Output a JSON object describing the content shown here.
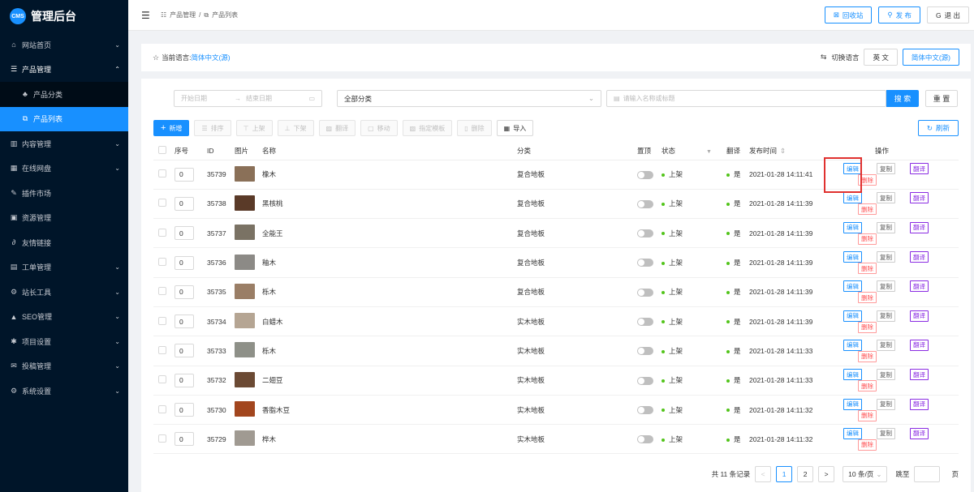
{
  "app": {
    "logo_badge": "CMS",
    "title": "管理后台"
  },
  "sidebar": {
    "items": [
      {
        "icon": "⌂",
        "label": "网站首页",
        "arrow": "⌄"
      },
      {
        "icon": "☰",
        "label": "产品管理",
        "arrow": "⌃"
      },
      {
        "icon": "▥",
        "label": "内容管理",
        "arrow": "⌄"
      },
      {
        "icon": "▦",
        "label": "在线网盘",
        "arrow": "⌄"
      },
      {
        "icon": "✎",
        "label": "插件市场",
        "arrow": ""
      },
      {
        "icon": "▣",
        "label": "资源管理",
        "arrow": ""
      },
      {
        "icon": "∂",
        "label": "友情链接",
        "arrow": ""
      },
      {
        "icon": "▤",
        "label": "工单管理",
        "arrow": "⌄"
      },
      {
        "icon": "⚙",
        "label": "站长工具",
        "arrow": "⌄"
      },
      {
        "icon": "▲",
        "label": "SEO管理",
        "arrow": "⌄"
      },
      {
        "icon": "✱",
        "label": "项目设置",
        "arrow": "⌄"
      },
      {
        "icon": "✉",
        "label": "投稿管理",
        "arrow": "⌄"
      },
      {
        "icon": "⚙",
        "label": "系统设置",
        "arrow": "⌄"
      }
    ],
    "submenu": [
      {
        "icon": "♣",
        "label": "产品分类"
      },
      {
        "icon": "⧉",
        "label": "产品列表"
      }
    ]
  },
  "topbar": {
    "fold_icon": "☰",
    "breadcrumb": [
      {
        "icon": "☷",
        "label": "产品管理"
      },
      {
        "icon": "⧉",
        "label": "产品列表"
      }
    ],
    "sep": "/",
    "recycle": {
      "icon": "⊠",
      "label": "回收站"
    },
    "publish": {
      "icon": "⚲",
      "label": "发 布"
    },
    "logout": {
      "icon": "G",
      "label": "退 出"
    }
  },
  "langbar": {
    "star": "☆",
    "label": "当前语言:",
    "current": "简体中文(源)",
    "switch_icon": "⇆",
    "switch_label": "切换语言",
    "options": [
      "英 文",
      "简体中文(源)"
    ]
  },
  "filters": {
    "start_date": "开始日期",
    "arrow": "→",
    "end_date": "结束日期",
    "calendar": "▭",
    "category": "全部分类",
    "caret": "⌄",
    "search_icon": "▤",
    "search_placeholder": "请输入名称或标题",
    "search_btn": "搜 索",
    "reset_btn": "重 置"
  },
  "toolbar": {
    "buttons": [
      {
        "icon": "+",
        "label": "新增"
      },
      {
        "icon": "☰",
        "label": "排序"
      },
      {
        "icon": "⊤",
        "label": "上架"
      },
      {
        "icon": "⊥",
        "label": "下架"
      },
      {
        "icon": "▨",
        "label": "翻译"
      },
      {
        "icon": "▢",
        "label": "移动"
      },
      {
        "icon": "▧",
        "label": "指定模板"
      },
      {
        "icon": "▯",
        "label": "删除"
      },
      {
        "icon": "▦",
        "label": "导入"
      }
    ],
    "refresh": {
      "icon": "↻",
      "label": "刷新"
    }
  },
  "table": {
    "headers": {
      "seq": "序号",
      "id": "ID",
      "image": "图片",
      "name": "名称",
      "category": "分类",
      "top": "置顶",
      "status": "状态",
      "filter": "▼",
      "translate": "翻译",
      "time": "发布时间",
      "sort": "⇕",
      "ops": "操作"
    },
    "ops": {
      "edit": "编辑",
      "copy": "复制",
      "translate": "翻译",
      "delete": "删除"
    },
    "rows": [
      {
        "seq": "0",
        "id": "35739",
        "color": "#8a7058",
        "name": "橡木",
        "category": "复合地板",
        "status": "上架",
        "translate": "是",
        "time": "2021-01-28 14:11:41"
      },
      {
        "seq": "0",
        "id": "35738",
        "color": "#5a3a28",
        "name": "黑核桃",
        "category": "复合地板",
        "status": "上架",
        "translate": "是",
        "time": "2021-01-28 14:11:39"
      },
      {
        "seq": "0",
        "id": "35737",
        "color": "#7a7264",
        "name": "全能王",
        "category": "复合地板",
        "status": "上架",
        "translate": "是",
        "time": "2021-01-28 14:11:39"
      },
      {
        "seq": "0",
        "id": "35736",
        "color": "#8c8a86",
        "name": "釉木",
        "category": "复合地板",
        "status": "上架",
        "translate": "是",
        "time": "2021-01-28 14:11:39"
      },
      {
        "seq": "0",
        "id": "35735",
        "color": "#9a7e66",
        "name": "栎木",
        "category": "复合地板",
        "status": "上架",
        "translate": "是",
        "time": "2021-01-28 14:11:39"
      },
      {
        "seq": "0",
        "id": "35734",
        "color": "#b5a593",
        "name": "白蜡木",
        "category": "实木地板",
        "status": "上架",
        "translate": "是",
        "time": "2021-01-28 14:11:39"
      },
      {
        "seq": "0",
        "id": "35733",
        "color": "#8e9088",
        "name": "栎木",
        "category": "实木地板",
        "status": "上架",
        "translate": "是",
        "time": "2021-01-28 14:11:33"
      },
      {
        "seq": "0",
        "id": "35732",
        "color": "#6b4a34",
        "name": "二翅豆",
        "category": "实木地板",
        "status": "上架",
        "translate": "是",
        "time": "2021-01-28 14:11:33"
      },
      {
        "seq": "0",
        "id": "35730",
        "color": "#a2461e",
        "name": "香脂木豆",
        "category": "实木地板",
        "status": "上架",
        "translate": "是",
        "time": "2021-01-28 14:11:32"
      },
      {
        "seq": "0",
        "id": "35729",
        "color": "#a09a92",
        "name": "桦木",
        "category": "实木地板",
        "status": "上架",
        "translate": "是",
        "time": "2021-01-28 14:11:32"
      }
    ]
  },
  "pagination": {
    "total": "共 11 条记录",
    "prev": "<",
    "pages": [
      "1",
      "2"
    ],
    "next": ">",
    "size": "10 条/页",
    "size_caret": "⌄",
    "jump": "跳至",
    "page_unit": "页"
  },
  "colors": {
    "accent": "#1890ff",
    "sidebar_bg": "#001529",
    "highlight": "#e0312f"
  }
}
